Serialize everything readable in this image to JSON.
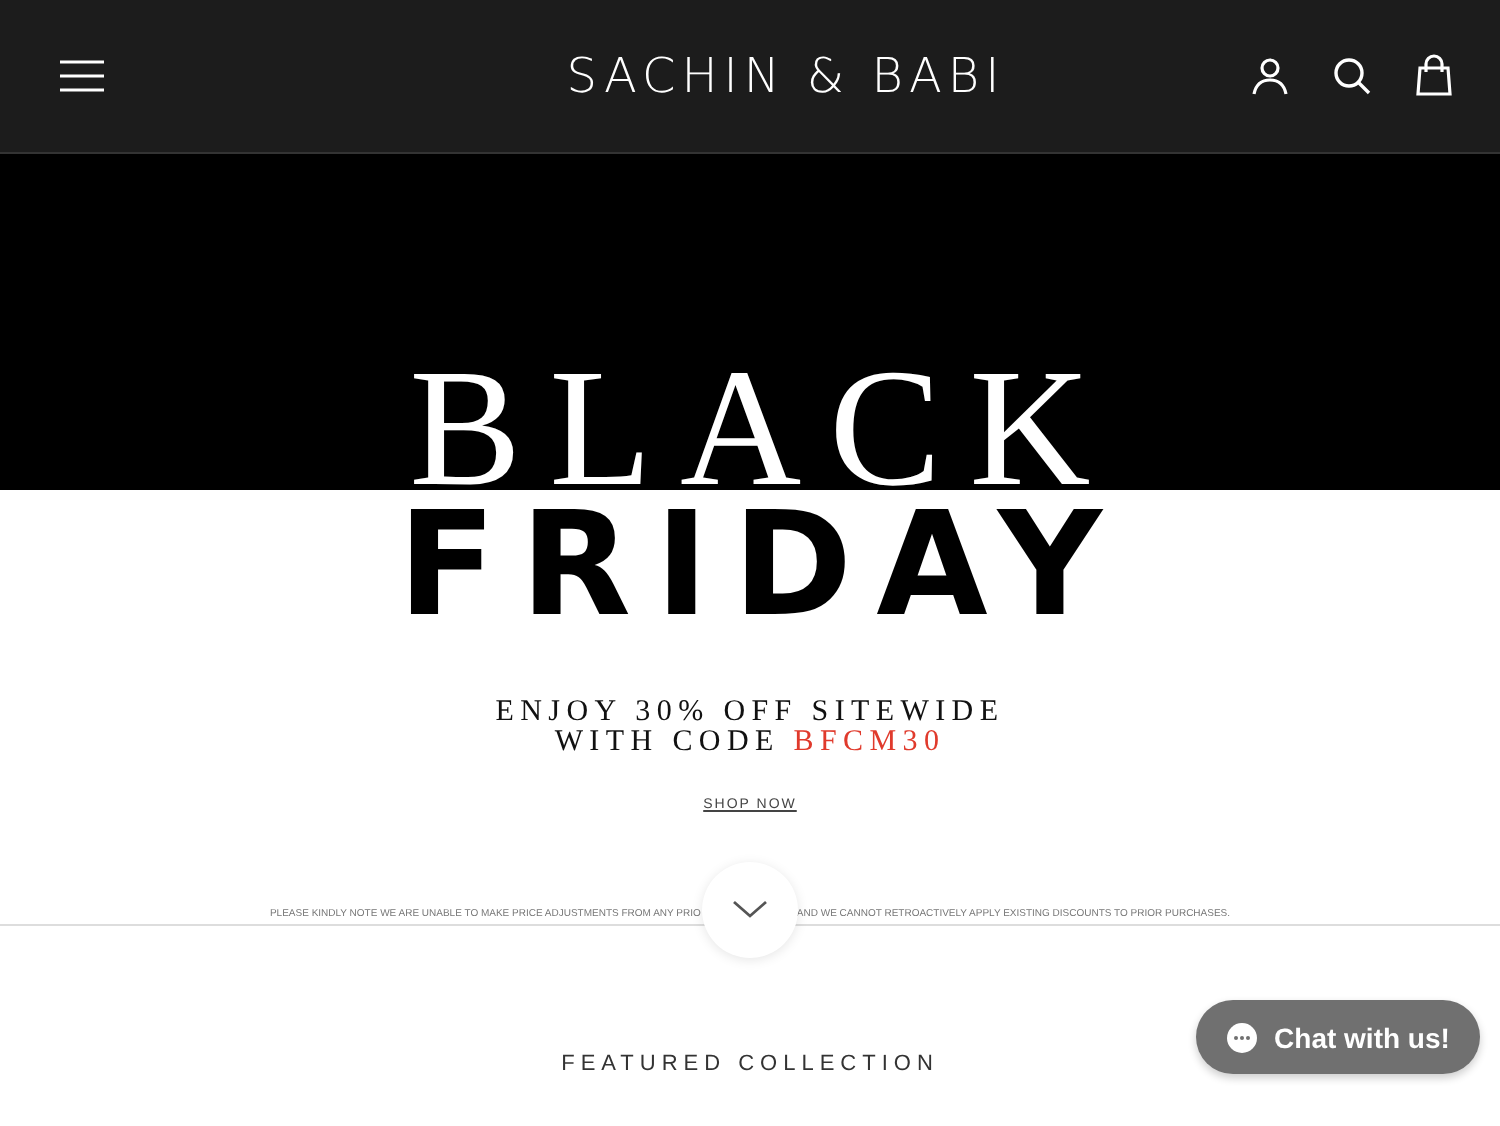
{
  "header": {
    "logo": "SACHIN & BABI"
  },
  "hero": {
    "line_1": "BLACK",
    "line_2": "FRIDAY"
  },
  "offer": {
    "line_1": "ENJOY 30% OFF SITEWIDE",
    "line_2_prefix": "WITH CODE",
    "code": "BFCM30"
  },
  "shop_link": "SHOP NOW",
  "note": {
    "part_1": "PLEASE KINDLY NOTE WE ARE UNABLE TO MAKE PRICE ADJUSTMENTS FROM ANY PRIO",
    "part_2": "AND WE CANNOT RETROACTIVELY APPLY EXISTING DISCOUNTS TO PRIOR PURCHASES."
  },
  "section_title": "FEATURED COLLECTION",
  "chat": {
    "label": "Chat with us!"
  }
}
